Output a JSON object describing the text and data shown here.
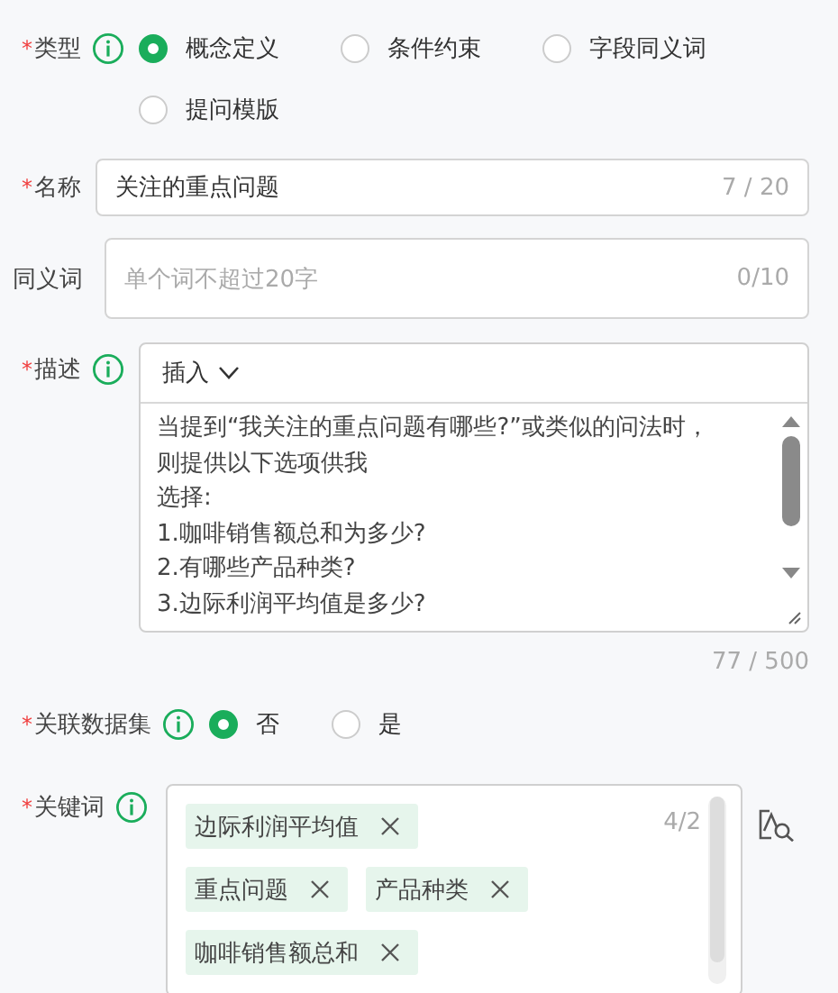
{
  "type_field": {
    "label": "类型",
    "required_mark": "*",
    "options": [
      {
        "label": "概念定义",
        "selected": true
      },
      {
        "label": "条件约束",
        "selected": false
      },
      {
        "label": "字段同义词",
        "selected": false
      },
      {
        "label": "提问模版",
        "selected": false
      }
    ]
  },
  "name_field": {
    "label": "名称",
    "required_mark": "*",
    "value": "关注的重点问题",
    "counter": "7 / 20"
  },
  "synonym_field": {
    "label": "同义词",
    "placeholder": "单个词不超过20字",
    "counter": "0/10"
  },
  "description_field": {
    "label": "描述",
    "required_mark": "*",
    "insert_menu": "插入",
    "lines": [
      "当提到“我关注的重点问题有哪些?”或类似的问法时，则提供以下选项供我",
      "选择:",
      "1.咖啡销售额总和为多少?",
      "2.有哪些产品种类?",
      "3.边际利润平均值是多少?"
    ],
    "counter": "77 / 500"
  },
  "dataset_field": {
    "label": "关联数据集",
    "required_mark": "*",
    "options": [
      {
        "label": "否",
        "selected": true
      },
      {
        "label": "是",
        "selected": false
      }
    ]
  },
  "keywords_field": {
    "label": "关键词",
    "required_mark": "*",
    "counter": "4/2",
    "tags": [
      {
        "label": "边际利润平均值"
      },
      {
        "label": "重点问题"
      },
      {
        "label": "产品种类"
      },
      {
        "label": "咖啡销售额总和"
      }
    ]
  }
}
